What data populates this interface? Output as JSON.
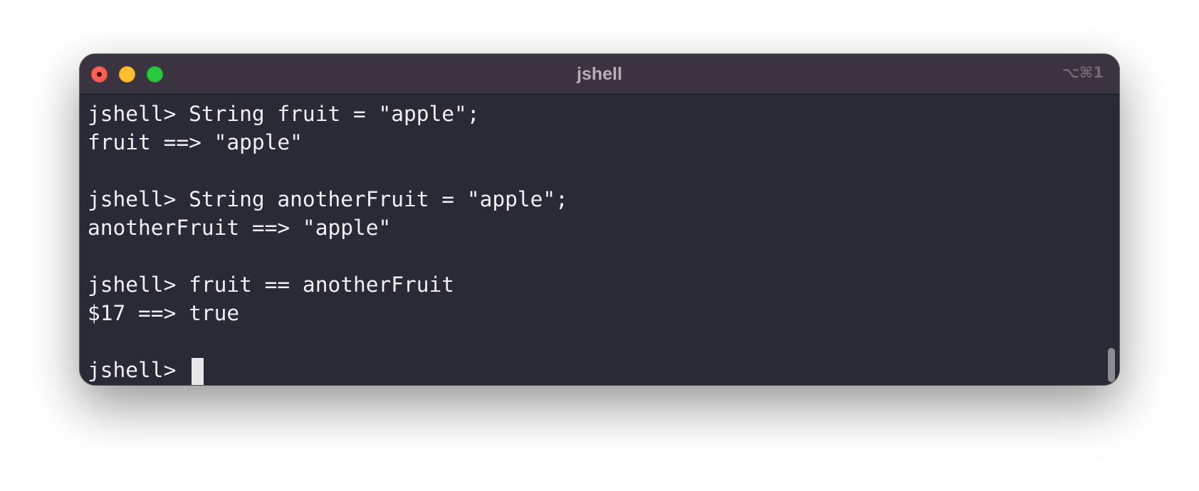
{
  "window": {
    "title": "jshell",
    "shortcut": "⌥⌘1"
  },
  "terminal": {
    "lines": [
      "jshell> String fruit = \"apple\";",
      "fruit ==> \"apple\"",
      "",
      "jshell> String anotherFruit = \"apple\";",
      "anotherFruit ==> \"apple\"",
      "",
      "jshell> fruit == anotherFruit",
      "$17 ==> true",
      ""
    ],
    "prompt": "jshell> "
  },
  "colors": {
    "background": "#282a36",
    "titlebar": "#3a3440",
    "text": "#f0f0f2",
    "close": "#fe5f57",
    "minimize": "#febc2e",
    "maximize": "#28c840"
  }
}
